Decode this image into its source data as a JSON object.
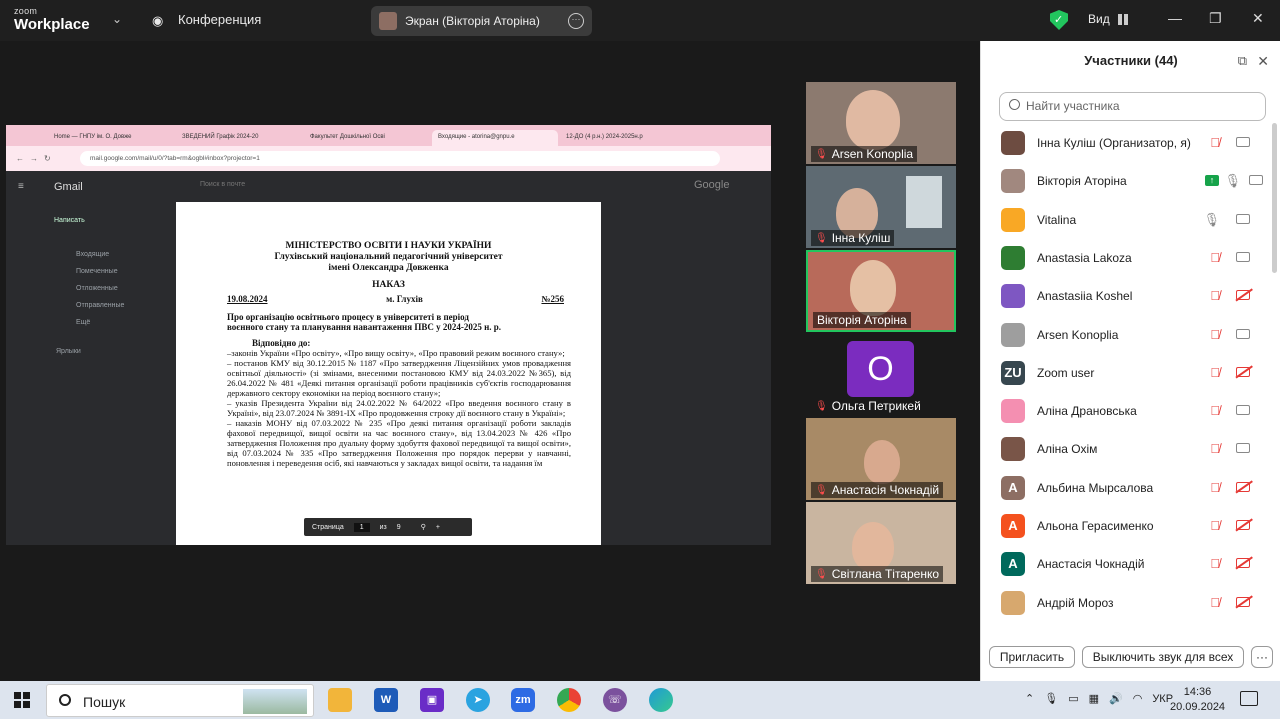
{
  "app": {
    "logo_top": "zoom",
    "logo_bottom": "Workplace",
    "conference_label": "Конференция",
    "screen_label": "Экран (Вікторія Аторіна)",
    "view_label": "Вид"
  },
  "browser": {
    "tabs": [
      "Home — ГНПУ ім. О. Довже",
      "ЗВЕДЕНИЙ Графік 2024-20",
      "Факультет Дошкільної Осві",
      "Входящие - atorina@gnpu.e",
      "12-ДО (4 р.н.) 2024-2025н.р"
    ],
    "url": "mail.google.com/mail/u/0/?tab=rm&ogbl#inbox?projector=1",
    "gmail_brand": "Gmail",
    "gmail_search": "Поиск в почте",
    "gmail_compose": "Написать",
    "google_brand": "Google",
    "gmail_labels": [
      "Входящие",
      "Помеченные",
      "Отложенные",
      "Отправленные",
      "Ещё"
    ],
    "gmail_section": "Ярлыки"
  },
  "document": {
    "line1": "МІНІСТЕРСТВО ОСВІТИ І НАУКИ УКРАЇНИ",
    "line2": "Глухівський національний педагогічний університет",
    "line3": "імені Олександра Довженка",
    "type": "НАКАЗ",
    "date": "19.08.2024",
    "city": "м. Глухів",
    "number": "№256",
    "subject": "Про організацію освітнього процесу в університеті в період воєнного стану та планування навантаження ПВС у 2024-2025 н. р.",
    "intro": "Відповідно до:",
    "p1": "–законів України «Про освіту», «Про вищу освіту», «Про правовий режим воєнного стану»;",
    "p2": "– постанов КМУ від 30.12.2015 № 1187 «Про затвердження Ліцензійних умов провадження освітньої діяльності» (зі змінами, внесеними постановою КМУ від 24.03.2022 №365), від 26.04.2022 № 481 «Деякі питання організації роботи працівників суб'єктів господарювання державного сектору економіки на період воєнного стану»;",
    "p3": "– указів Президента України від 24.02.2022 № 64/2022 «Про введення воєнного стану в Україні», від 23.07.2024 № 3891-IX «Про продовження строку дії воєнного стану в Україні»;",
    "p4": "– наказів МОНУ від 07.03.2022 № 235 «Про деякі питання організації роботи закладів фахової передвищої, вищої освіти на час воєнного стану», від 13.04.2023 № 426 «Про затвердження Положення про дуальну форму здобуття фахової передвищої та вищої освіти», від 07.03.2024 № 335 «Про затвердження Положення про порядок перерви у навчанні, поновлення і переведення осіб, які навчаються у закладах вищої освіти, та надання їм",
    "pager_label": "Страница",
    "pager_page": "1",
    "pager_of": "из",
    "pager_total": "9"
  },
  "videos": [
    {
      "name": "Arsen Konoplia"
    },
    {
      "name": "Інна Куліш"
    },
    {
      "name": "Вікторія Аторіна"
    },
    {
      "name": "Ольга Петрикей",
      "initial": "O"
    },
    {
      "name": "Анастасія Чокнадій"
    },
    {
      "name": "Світлана Тітаренко"
    }
  ],
  "panel": {
    "title": "Участники (44)",
    "search_placeholder": "Найти участника",
    "participants": [
      {
        "name": "Інна Куліш (Организатор, я)",
        "color": "#6d4c41"
      },
      {
        "name": "Вікторія Аторіна",
        "color": "#a1887f"
      },
      {
        "name": "Vitalina",
        "color": "#f9a825"
      },
      {
        "name": "Anastasia Lakoza",
        "color": "#2e7d32"
      },
      {
        "name": "Anastasiia Koshel",
        "color": "#7e57c2"
      },
      {
        "name": "Arsen Konoplia",
        "color": "#9e9e9e"
      },
      {
        "name": "Zoom user",
        "initial": "ZU",
        "color": "#37474f"
      },
      {
        "name": "Аліна Драновська",
        "color": "#f48fb1"
      },
      {
        "name": "Аліна Охім",
        "color": "#795548"
      },
      {
        "name": "Альбина Мырсалова",
        "initial": "А",
        "color": "#8d6e63"
      },
      {
        "name": "Альона Герасименко",
        "initial": "А",
        "color": "#f4511e"
      },
      {
        "name": "Анастасія Чокнадій",
        "initial": "А",
        "color": "#00695c"
      },
      {
        "name": "Андрій Мороз",
        "color": "#d7a86e"
      }
    ],
    "invite_label": "Пригласить",
    "mute_all_label": "Выключить звук для всех"
  },
  "taskbar": {
    "search_label": "Пошук",
    "lang": "УКР",
    "time": "14:36",
    "date": "20.09.2024"
  }
}
